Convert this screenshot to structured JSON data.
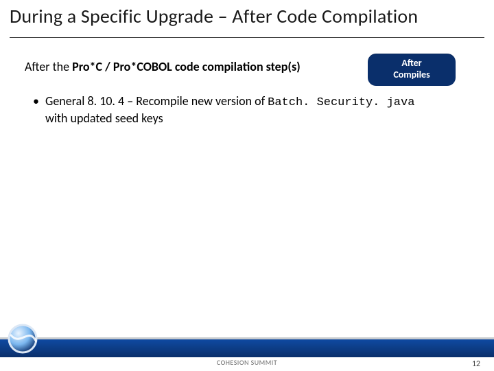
{
  "title": "During a Specific Upgrade – After Code Compilation",
  "subhead": {
    "pre": "After the ",
    "bold": "Pro*C / Pro*COBOL code compilation step(s)"
  },
  "badge": "After\nCompiles",
  "bullets": [
    {
      "prefix": "General 8. 10. 4 – Recompile new version of ",
      "code": "Batch. Security. java",
      "suffix": " with updated seed keys"
    }
  ],
  "footer": "COHESION SUMMIT",
  "page_number": "12"
}
